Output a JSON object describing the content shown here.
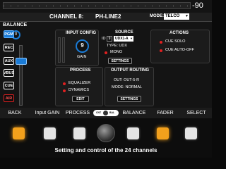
{
  "header": {
    "level_readout": "-90",
    "channel_label": "CHANNEL 8:",
    "channel_name": "PH-LINE2",
    "mode_label": "MODE:",
    "mode_value": "TELCO"
  },
  "balance": {
    "label": "BALANCE",
    "value": "0"
  },
  "routing_buttons": [
    {
      "label": "PGM",
      "active": true
    },
    {
      "label": "REC",
      "active": false
    },
    {
      "label": "AUX",
      "active": false
    },
    {
      "label": "VBUS",
      "active": false
    },
    {
      "label": "CUE",
      "active": false
    },
    {
      "label": "AIR",
      "active": false
    }
  ],
  "input_config": {
    "title": "INPUT CONFIG",
    "gain_value": "9",
    "gain_label": "GAIN"
  },
  "source": {
    "title": "SOURCE",
    "id_label": "ID",
    "id_value": "9",
    "select_value": "UDX1-A",
    "type_text": "TYPE: UDX",
    "mono_label": "MONO",
    "settings_label": "SETTINGS"
  },
  "actions": {
    "title": "ACTIONS",
    "items": [
      "CUE SOLO",
      "CUE AUTO-OFF"
    ]
  },
  "process": {
    "title": "PROCESS",
    "items": [
      "EQUALIZER",
      "DYNAMICS"
    ],
    "edit_label": "EDIT"
  },
  "output_routing": {
    "title": "OUTPUT ROUTING",
    "out_text": "OUT: OUT-5-R",
    "mode_text": "MODE: NORMAL",
    "settings_label": "SETTINGS"
  },
  "function_bar": {
    "items": [
      "BACK",
      "Input GAIN",
      "PROCESS",
      "BALANCE",
      "FADER",
      "SELECT"
    ],
    "knob_labels": [
      "CNT",
      "BAL"
    ]
  },
  "hardware_buttons_lit": [
    true,
    false,
    false,
    false,
    false,
    true,
    false
  ],
  "caption": "Setting and control of the 24 channels",
  "colors": {
    "accent_blue": "#1a7bd6",
    "air_red": "#e02020",
    "led_red": "#e02020",
    "button_orange": "#f2a01c"
  }
}
